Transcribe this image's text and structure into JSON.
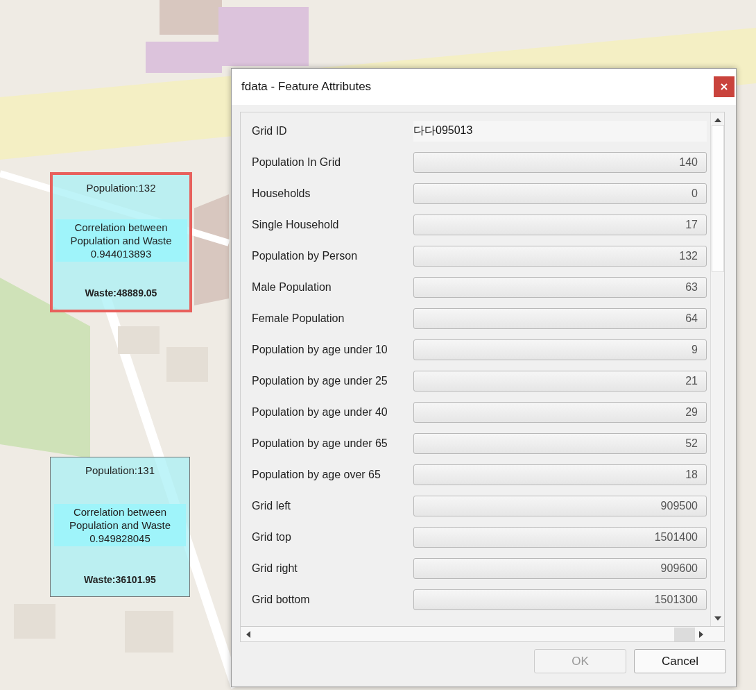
{
  "map": {
    "grid_cells": [
      {
        "population": "Population:132",
        "correlation": [
          "Correlation between",
          "Population and Waste",
          "0.944013893"
        ],
        "waste": "Waste:48889.05",
        "selected": true
      },
      {
        "population": "Population:131",
        "correlation": [
          "Correlation between",
          "Population and Waste",
          "0.949828045"
        ],
        "waste": "Waste:36101.95",
        "selected": false
      }
    ]
  },
  "dialog": {
    "title": "fdata - Feature Attributes",
    "fields": [
      {
        "label": "Grid ID",
        "value": "다다095013",
        "editable": true
      },
      {
        "label": "Population In Grid",
        "value": "140",
        "editable": false
      },
      {
        "label": "Households",
        "value": "0",
        "editable": false
      },
      {
        "label": "Single Household",
        "value": "17",
        "editable": false
      },
      {
        "label": "Population by Person",
        "value": "132",
        "editable": false
      },
      {
        "label": "Male Population",
        "value": "63",
        "editable": false
      },
      {
        "label": "Female Population",
        "value": "64",
        "editable": false
      },
      {
        "label": "Population by age under 10",
        "value": "9",
        "editable": false
      },
      {
        "label": "Population by age under 25",
        "value": "21",
        "editable": false
      },
      {
        "label": "Population by age under 40",
        "value": "29",
        "editable": false
      },
      {
        "label": "Population by age under 65",
        "value": "52",
        "editable": false
      },
      {
        "label": "Population by age over 65",
        "value": "18",
        "editable": false
      },
      {
        "label": "Grid left",
        "value": "909500",
        "editable": false
      },
      {
        "label": "Grid top",
        "value": "1501400",
        "editable": false
      },
      {
        "label": "Grid right",
        "value": "909600",
        "editable": false
      },
      {
        "label": "Grid bottom",
        "value": "1501300",
        "editable": false
      }
    ],
    "buttons": [
      {
        "label": "OK",
        "disabled": true
      },
      {
        "label": "Cancel",
        "disabled": false
      }
    ]
  }
}
